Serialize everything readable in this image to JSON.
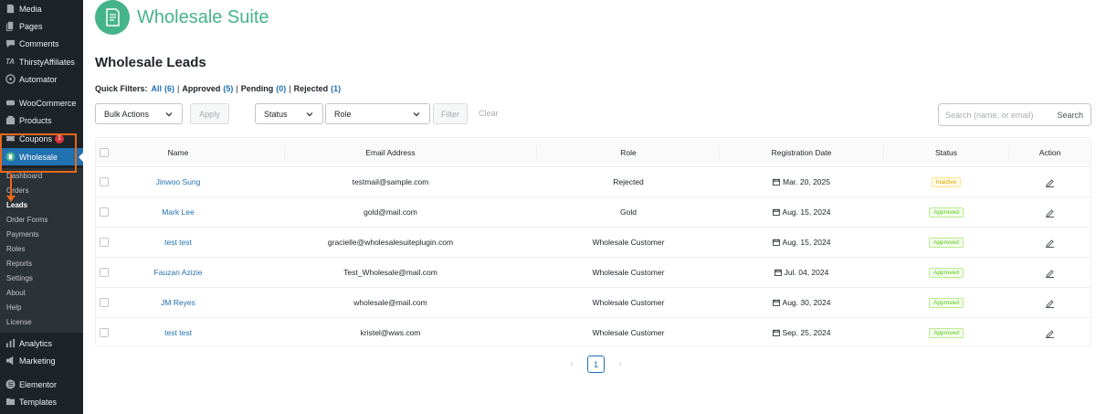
{
  "sidebar": {
    "items": [
      {
        "label": "Media",
        "icon": "media-icon"
      },
      {
        "label": "Pages",
        "icon": "pages-icon"
      },
      {
        "label": "Comments",
        "icon": "comments-icon"
      },
      {
        "label": "ThirstyAffiliates",
        "icon": "thirstyaffiliates-icon",
        "icon_text": "TA"
      },
      {
        "label": "Automator",
        "icon": "automator-icon"
      },
      {
        "label": "WooCommerce",
        "icon": "woocommerce-icon"
      },
      {
        "label": "Products",
        "icon": "products-icon"
      },
      {
        "label": "Coupons",
        "icon": "coupons-icon",
        "badge": "1"
      },
      {
        "label": "Wholesale",
        "icon": "wholesale-icon"
      },
      {
        "label": "Analytics",
        "icon": "analytics-icon"
      },
      {
        "label": "Marketing",
        "icon": "marketing-icon"
      },
      {
        "label": "Elementor",
        "icon": "elementor-icon"
      },
      {
        "label": "Templates",
        "icon": "templates-icon"
      }
    ],
    "submenu": [
      {
        "label": "Dashboard"
      },
      {
        "label": "Orders"
      },
      {
        "label": "Leads",
        "current": true
      },
      {
        "label": "Order Forms"
      },
      {
        "label": "Payments"
      },
      {
        "label": "Roles"
      },
      {
        "label": "Reports"
      },
      {
        "label": "Settings"
      },
      {
        "label": "About"
      },
      {
        "label": "Help"
      },
      {
        "label": "License"
      }
    ],
    "highlight_color": "#e8671a",
    "active_color": "#2271b1"
  },
  "header": {
    "brand": "Wholesale Suite",
    "brand_color": "#46b48a",
    "page_title": "Wholesale Leads"
  },
  "quick_filters": {
    "label": "Quick Filters:",
    "items": [
      {
        "label": "All",
        "count": "(6)",
        "active": true
      },
      {
        "label": "Approved",
        "count": "(5)"
      },
      {
        "label": "Pending",
        "count": "(0)"
      },
      {
        "label": "Rejected",
        "count": "(1)"
      }
    ],
    "separator": "|"
  },
  "controls": {
    "bulk_actions": "Bulk Actions",
    "apply": "Apply",
    "status": "Status",
    "role": "Role",
    "filter": "Filter",
    "clear": "Clear",
    "search_placeholder": "Search (name, or email)",
    "search": "Search"
  },
  "table": {
    "columns": [
      "Name",
      "Email Address",
      "Role",
      "Registration Date",
      "Status",
      "Action"
    ],
    "rows": [
      {
        "name": "Jinwoo Sung",
        "email": "testmail@sample.com",
        "role": "Rejected",
        "date": "Mar. 20, 2025",
        "status": "Inactive",
        "status_type": "inactive"
      },
      {
        "name": "Mark Lee",
        "email": "gold@mail.com",
        "role": "Gold",
        "date": "Aug. 15, 2024",
        "status": "Approved",
        "status_type": "approved"
      },
      {
        "name": "test test",
        "email": "gracielle@wholesalesuiteplugin.com",
        "role": "Wholesale Customer",
        "date": "Aug. 15, 2024",
        "status": "Approved",
        "status_type": "approved"
      },
      {
        "name": "Fauzan Azizie",
        "email": "Test_Wholesale@mail.com",
        "role": "Wholesale Customer",
        "date": "Jul. 04, 2024",
        "status": "Approved",
        "status_type": "approved"
      },
      {
        "name": "JM Reyes",
        "email": "wholesale@mail.com",
        "role": "Wholesale Customer",
        "date": "Aug. 30, 2024",
        "status": "Approved",
        "status_type": "approved"
      },
      {
        "name": "test test",
        "email": "kristel@wws.com",
        "role": "Wholesale Customer",
        "date": "Sep. 25, 2024",
        "status": "Approved",
        "status_type": "approved"
      }
    ]
  },
  "pagination": {
    "current_page": "1",
    "prev": "‹",
    "next": "›"
  }
}
